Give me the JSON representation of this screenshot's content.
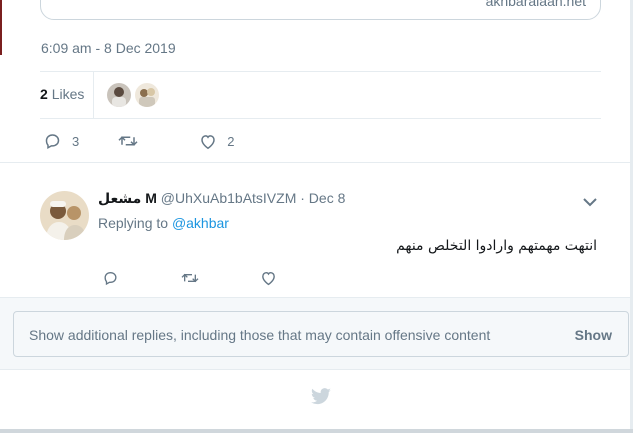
{
  "tweet": {
    "link_domain": "akhbaralaan.net",
    "timestamp": "6:09 am - 8 Dec 2019",
    "likes": {
      "count": "2",
      "label": "Likes"
    },
    "actions": {
      "reply_count": "3",
      "retweet_count": "",
      "like_count": "2"
    }
  },
  "reply": {
    "display_name": "مشعل M",
    "handle_date": "@UhXuAb1bAtsIVZM · Dec 8",
    "replying_prefix": "Replying to",
    "replying_to": "@akhbar",
    "text": "انتهت مهمتهم وارادوا التخلص منهم"
  },
  "more_replies": {
    "message": "Show additional replies, including those that may contain offensive content",
    "button": "Show"
  },
  "icons": {
    "reply": "reply-icon",
    "retweet": "retweet-icon",
    "like": "heart-icon",
    "chevron": "chevron-down-icon",
    "footer": "twitter-bird-icon"
  },
  "colors": {
    "secondary_text": "#657786",
    "link": "#1b95e0",
    "border": "#e6ecf0",
    "panel_bg": "#f5f8fa"
  }
}
